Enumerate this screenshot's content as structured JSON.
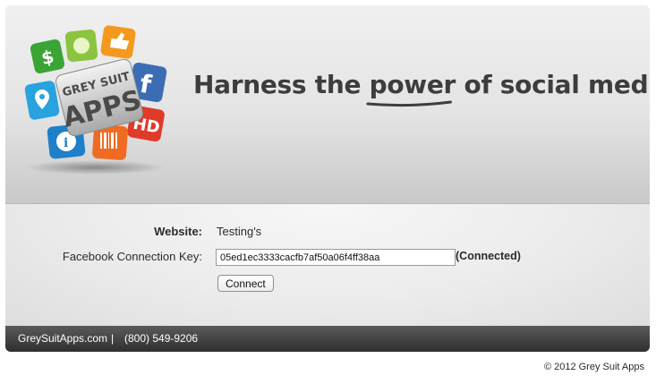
{
  "header": {
    "logo_text_top": "GREY SUIT",
    "logo_text_bottom": "APPS",
    "tagline_before": "Harness the ",
    "tagline_highlight": "power",
    "tagline_after": " of social media."
  },
  "form": {
    "website_label": "Website:",
    "website_value": "Testing's",
    "key_label": "Facebook Connection Key:",
    "key_value": "05ed1ec3333cacfb7af50a06f4ff38aa",
    "status": "(Connected)",
    "connect_button": "Connect"
  },
  "footer": {
    "site_link": "GreySuitApps.com",
    "separator": "|",
    "phone": "(800) 549-9206",
    "copyright": "© 2012 Grey Suit Apps"
  },
  "colors": {
    "tagline": "#3d3d3d",
    "footer_bar": "#3a3a3a"
  }
}
